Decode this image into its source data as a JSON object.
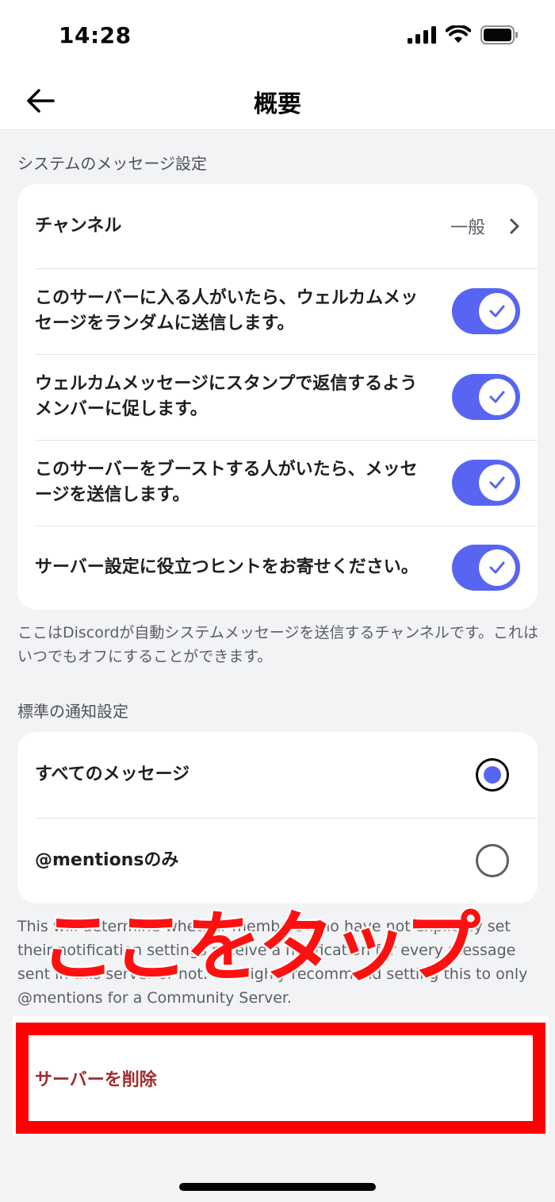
{
  "status": {
    "time": "14:28"
  },
  "nav": {
    "title": "概要"
  },
  "system_section": {
    "heading": "システムのメッセージ設定",
    "channel_label": "チャンネル",
    "channel_value": "一般",
    "toggles": [
      {
        "label": "このサーバーに入る人がいたら、ウェルカムメッセージをランダムに送信します。",
        "on": true
      },
      {
        "label": "ウェルカムメッセージにスタンプで返信するようメンバーに促します。",
        "on": true
      },
      {
        "label": "このサーバーをブーストする人がいたら、メッセージを送信します。",
        "on": true
      },
      {
        "label": "サーバー設定に役立つヒントをお寄せください。",
        "on": true
      }
    ],
    "help": "ここはDiscordが自動システムメッセージを送信するチャンネルです。これはいつでもオフにすることができます。"
  },
  "notify_section": {
    "heading": "標準の通知設定",
    "options": [
      {
        "label": "すべてのメッセージ",
        "selected": true
      },
      {
        "label": "@mentionsのみ",
        "selected": false
      }
    ],
    "help": "This will determine whether members who have not explicitly set their notification settings receive a notification for every message sent in this server or not. We highly recommend setting this to only @mentions for a Community Server."
  },
  "delete": {
    "label": "サーバーを削除"
  },
  "annotation": {
    "text": "ここをタップ"
  },
  "colors": {
    "accent": "#5865f2",
    "danger": "#a12d2f",
    "highlight": "#ff0000"
  }
}
